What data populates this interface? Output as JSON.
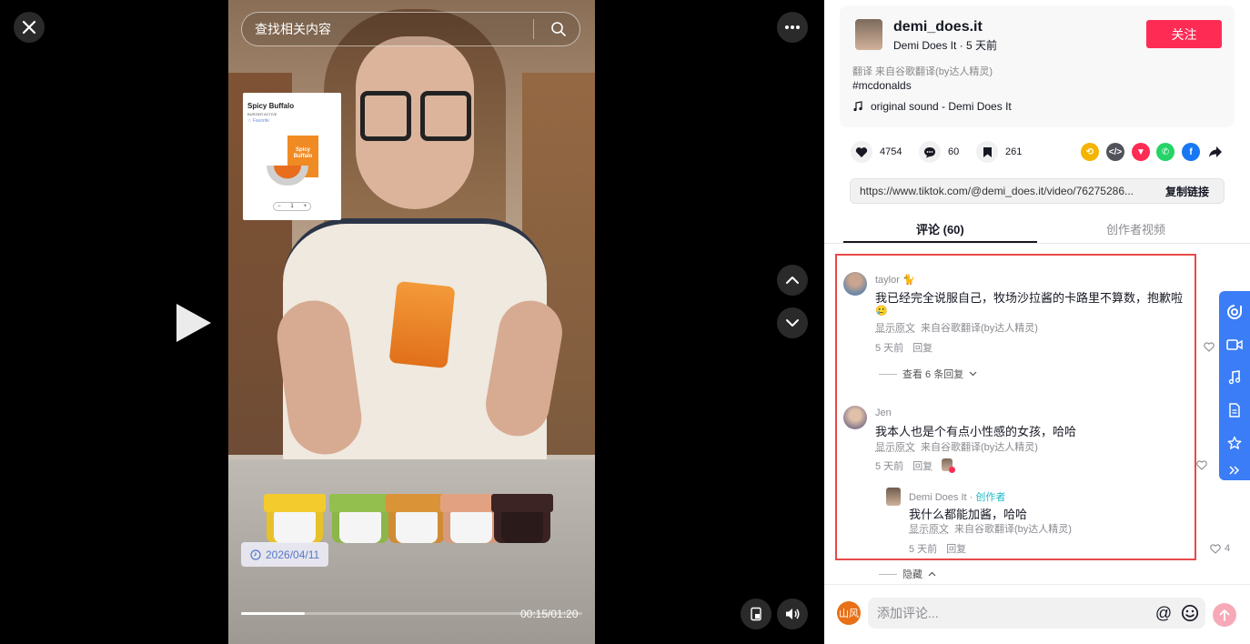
{
  "video": {
    "search_placeholder": "查找相关内容",
    "date_chip": "2026/04/11",
    "time_label": "00:15/01:20",
    "progress": 0.1875,
    "product": {
      "title": "Spicy Buffalo",
      "sub": "BURGER ACTIVE",
      "fav": "Favorite",
      "box_label": "Spicy Buffalo",
      "qty": "1"
    }
  },
  "author": {
    "username": "demi_does.it",
    "display_line": "Demi Does It · 5 天前",
    "follow_label": "关注",
    "translate_line": "翻译 来自谷歌翻译(by达人精灵)",
    "hashtag": "#mcdonalds",
    "music": "original sound - Demi Does It"
  },
  "stats": {
    "likes": "4754",
    "comments": "60",
    "saves": "261"
  },
  "share_icons": [
    "repost-icon",
    "embed-icon",
    "send-icon",
    "whatsapp-icon",
    "facebook-icon",
    "share-arrow-icon"
  ],
  "share_colors": {
    "repost": "#f4b400",
    "embed": "#505359",
    "send": "#fe2c55",
    "whatsapp": "#25d366",
    "facebook": "#1877f2"
  },
  "link": {
    "url": "https://www.tiktok.com/@demi_does.it/video/76275286...",
    "copy_label": "复制链接"
  },
  "tabs": {
    "comments": "评论 (60)",
    "creator_videos": "创作者视频"
  },
  "comments": [
    {
      "user": "taylor 🐈",
      "text": "我已经完全说服自己，牧场沙拉酱的卡路里不算数，抱歉啦",
      "text_line2": "🥲",
      "show_original": "显示原文",
      "translation": "来自谷歌翻译(by达人精灵)",
      "time": "5 天前",
      "reply": "回复",
      "view_replies": "查看 6 条回复"
    },
    {
      "user": "Jen",
      "text": "我本人也是个有点小性感的女孩，哈哈",
      "show_original": "显示原文",
      "translation": "来自谷歌翻译(by达人精灵)",
      "time": "5 天前",
      "reply": "回复"
    }
  ],
  "creator_reply": {
    "user": "Demi Does It · ",
    "tag": "创作者",
    "text": "我什么都能加酱，哈哈",
    "show_original": "显示原文",
    "translation": "来自谷歌翻译(by达人精灵)",
    "time": "5 天前",
    "reply": "回复",
    "likes": "4"
  },
  "hide_label": "隐藏",
  "compose": {
    "me_avatar_text": "山风",
    "placeholder": "添加评论..."
  },
  "accent_color": "#fe2c55",
  "highlight_border_color": "#e84a4a",
  "rail_color": "#3a7df6"
}
